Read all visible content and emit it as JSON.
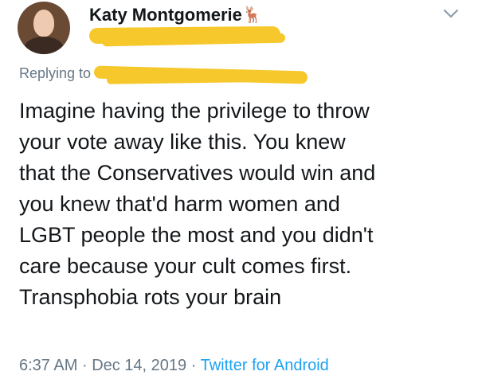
{
  "header": {
    "display_name": "Katy Montgomerie",
    "name_emoji": "🦌"
  },
  "reply": {
    "label": "Replying to"
  },
  "tweet": {
    "lines": [
      "Imagine having the privilege to throw",
      "your vote away like this. You knew",
      "that the Conservatives would win and",
      "you knew that'd harm women and",
      "LGBT people the most and you didn't",
      "care because your cult comes first.",
      "Transphobia rots your brain"
    ]
  },
  "meta": {
    "time": "6:37 AM",
    "separator": "·",
    "date": "Dec 14, 2019",
    "source": "Twitter for Android"
  },
  "colors": {
    "text": "#14171a",
    "secondary": "#657786",
    "link": "#1da1f2",
    "redaction": "#f6c82b"
  },
  "icons": {
    "more": "chevron-down-icon",
    "avatar": "profile-avatar"
  }
}
